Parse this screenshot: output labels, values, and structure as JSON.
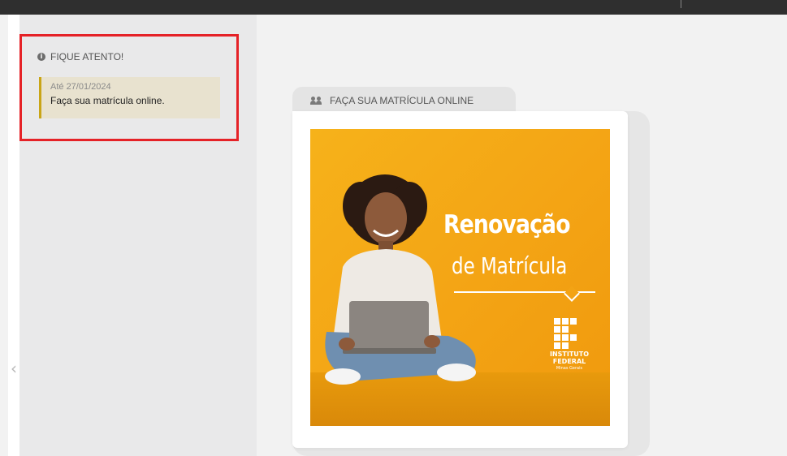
{
  "sidebar": {
    "notice_title": "FIQUE ATENTO!",
    "notice_icon": "info-icon",
    "notice": {
      "date": "Até 27/01/2024",
      "text": "Faça sua matrícula online."
    }
  },
  "main": {
    "card_tab": {
      "label": "FAÇA SUA MATRÍCULA ONLINE",
      "icon": "people-icon"
    },
    "banner": {
      "title": "Renovação",
      "subtitle": "de Matrícula",
      "logo_line1": "INSTITUTO",
      "logo_line2": "FEDERAL",
      "logo_line3": "Minas Gerais"
    },
    "prev_arrow": "‹"
  },
  "colors": {
    "highlight": "#e52227",
    "notice_bg": "#e8e2cf",
    "notice_border": "#c9a516",
    "banner_yellow": "#f4a515"
  }
}
